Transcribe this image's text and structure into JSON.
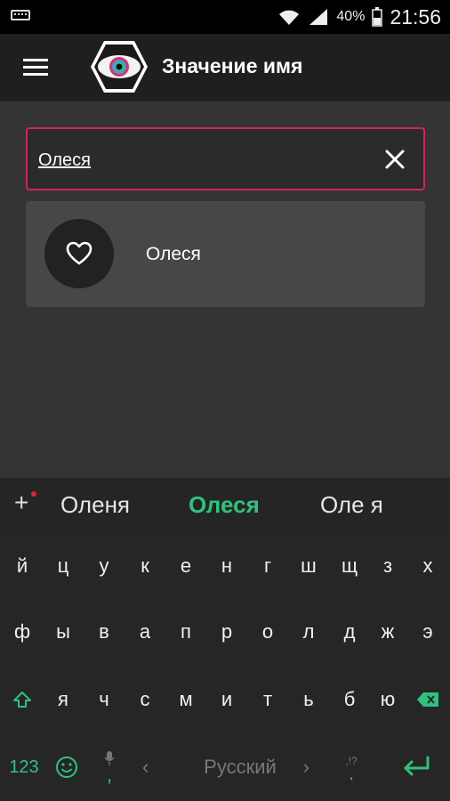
{
  "status": {
    "battery": "40%",
    "time": "21:56"
  },
  "appbar": {
    "title": "Значение имя"
  },
  "search": {
    "value": "Олеся"
  },
  "results": [
    {
      "name": "Олеся"
    }
  ],
  "keyboard": {
    "suggestions": [
      "Оленя",
      "Олеся",
      "Оле я"
    ],
    "row1": [
      "й",
      "ц",
      "у",
      "к",
      "е",
      "н",
      "г",
      "ш",
      "щ",
      "з",
      "х"
    ],
    "row2": [
      "ф",
      "ы",
      "в",
      "а",
      "п",
      "р",
      "о",
      "л",
      "д",
      "ж",
      "э"
    ],
    "row3": [
      "я",
      "ч",
      "с",
      "м",
      "и",
      "т",
      "ь",
      "б",
      "ю"
    ],
    "numbers_label": "123",
    "language_label": "Русский",
    "comma": ",",
    "punct_label": ",!?",
    "period": ".",
    "accent_color": "#2ec27e"
  },
  "colors": {
    "search_border": "#d1245f",
    "card": "#474747",
    "background": "#343434"
  }
}
